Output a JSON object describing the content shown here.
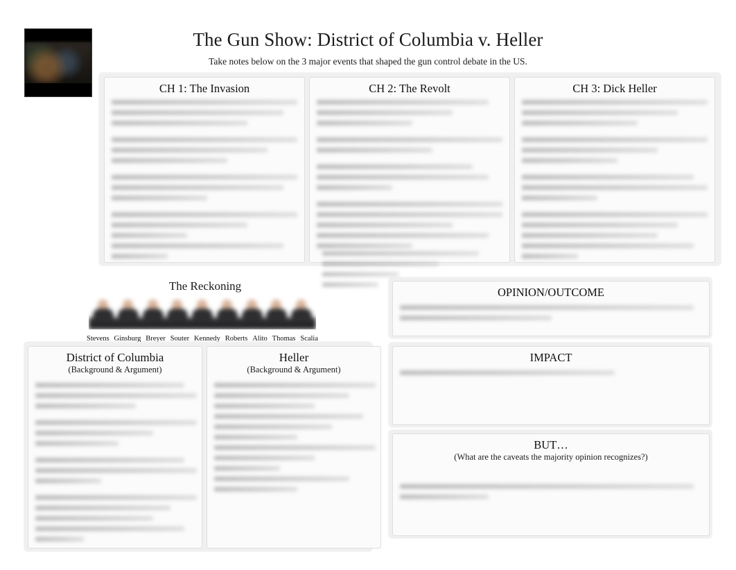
{
  "document": {
    "title": "The Gun Show: District of Columbia v. Heller",
    "subtitle": "Take notes below on the 3 major events that shaped the gun control debate in the US.",
    "thumbnail_name": "video-thumbnail"
  },
  "chapters": [
    {
      "heading": "CH 1: The Invasion"
    },
    {
      "heading": "CH 2: The Revolt"
    },
    {
      "heading": "CH 3: Dick Heller"
    }
  ],
  "reckoning": {
    "heading": "The Reckoning",
    "photo_name": "supreme-court-justices-photo",
    "justices": [
      "Stevens",
      "Ginsburg",
      "Breyer",
      "Souter",
      "Kennedy",
      "Roberts",
      "Alito",
      "Thomas",
      "Scalia"
    ]
  },
  "parties": [
    {
      "heading": "District of Columbia",
      "subheading": "(Background & Argument)"
    },
    {
      "heading": "Heller",
      "subheading": "(Background & Argument)"
    }
  ],
  "sections": {
    "outcome": {
      "heading": "OPINION/OUTCOME"
    },
    "impact": {
      "heading": "IMPACT"
    },
    "but": {
      "heading": "BUT…",
      "subheading": "(What are the caveats the majority opinion recognizes?)"
    }
  },
  "colors": {
    "page_background": "#ffffff",
    "panel_background": "#f0f0f0",
    "card_background": "#fbfbfb",
    "card_border": "#dedede",
    "text": "#1a1a1a"
  }
}
